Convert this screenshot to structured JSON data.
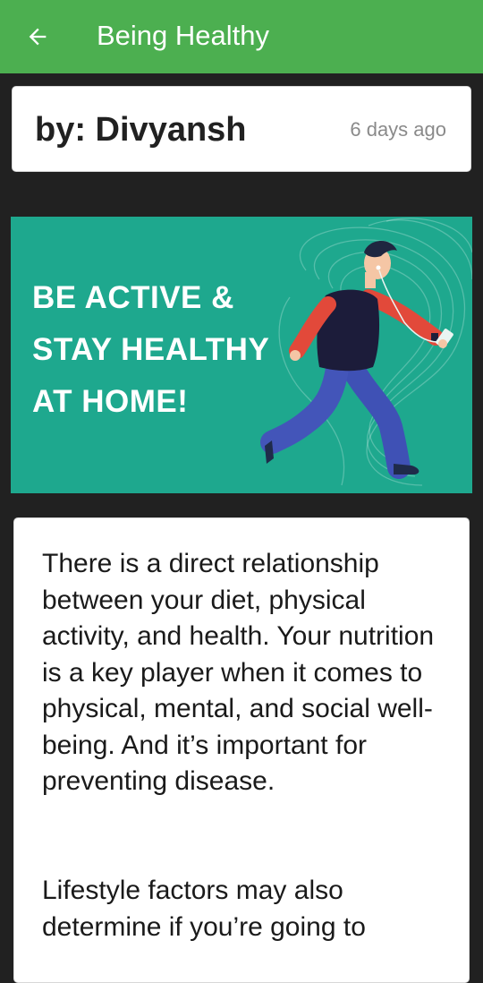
{
  "app_bar": {
    "back_icon": "arrow-left-icon",
    "title": "Being Healthy",
    "color": "#4CAF50"
  },
  "author_card": {
    "author": "by: Divyansh",
    "time": "6 days ago"
  },
  "banner": {
    "line1": "BE ACTIVE &",
    "line2": "STAY HEALTHY",
    "line3": "AT HOME!",
    "background": "#1EA88E",
    "illustration": "running-man-with-headphones-and-phone"
  },
  "article": {
    "paragraph1": "There is a direct relationship between your diet, physical activity, and health. Your nutrition is a key player when it comes to physical, mental, and social well-being. And it’s important for preventing disease.",
    "paragraph2": "Lifestyle factors may also determine if you’re going to"
  }
}
